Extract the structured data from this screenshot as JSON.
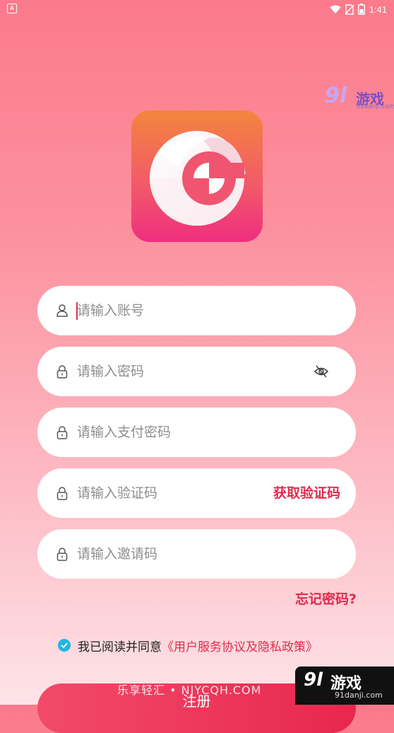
{
  "status_bar": {
    "left_badge": "A",
    "time": "1:41",
    "icons": [
      "wifi-icon",
      "sim-no-signal-icon",
      "battery-icon"
    ]
  },
  "watermark_top": {
    "logo": "9l",
    "brand": "游戏",
    "url": "91danji.com"
  },
  "app_logo": {
    "icon": "g-letter-logo",
    "colors": {
      "top": "#f4853d",
      "bottom": "#ef2e7f"
    }
  },
  "form": {
    "account": {
      "placeholder": "请输入账号",
      "value": "",
      "icon": "user-icon"
    },
    "password": {
      "placeholder": "请输入密码",
      "value": "",
      "icon": "lock-icon",
      "toggle_icon": "eye-off-icon"
    },
    "pay_password": {
      "placeholder": "请输入支付密码",
      "value": "",
      "icon": "lock-icon"
    },
    "verify_code": {
      "placeholder": "请输入验证码",
      "value": "",
      "icon": "lock-icon",
      "get_code_label": "获取验证码"
    },
    "invite_code": {
      "placeholder": "请输入邀请码",
      "value": "",
      "icon": "lock-icon"
    }
  },
  "forgot_password": "忘记密码?",
  "agreement": {
    "checked": true,
    "text": "我已阅读并同意",
    "link": "《用户服务协议及隐私政策》"
  },
  "submit": {
    "label": "注册"
  },
  "watermark_bottom": {
    "text": "乐享轻汇 • NJYCQH.COM",
    "badge_logo": "9l",
    "badge_brand": "游戏",
    "badge_url": "91danji.com"
  },
  "colors": {
    "accent": "#e32a4d",
    "check": "#22b6e6",
    "bg_top": "#fb7a8b",
    "bg_bottom": "#fde4e8"
  }
}
